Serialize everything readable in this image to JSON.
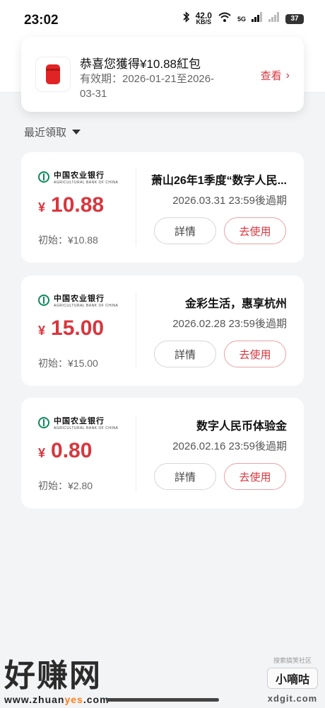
{
  "status_bar": {
    "time": "23:02",
    "net_speed_value": "42.0",
    "net_speed_unit": "KB/S",
    "signal_label": "5G",
    "battery": "37",
    "icons": [
      "bluetooth-icon",
      "wifi-icon",
      "signal-icon",
      "signal-icon"
    ]
  },
  "toast": {
    "title": "恭喜您獲得¥10.88紅包",
    "validity": "有效期：2026-01-21至2026-03-31",
    "action_label": "查看",
    "icon": "red-envelope-icon",
    "accent_color": "#d9363e"
  },
  "section": {
    "label": "最近領取"
  },
  "coupons": [
    {
      "bank_name_cn": "中国农业银行",
      "bank_name_en": "AGRICULTURAL BANK OF CHINA",
      "currency": "¥",
      "amount": "10.88",
      "initial": "初始：¥10.88",
      "title": "萧山26年1季度“数字人民...",
      "expiry": "2026.03.31 23:59後過期",
      "detail_label": "詳情",
      "use_label": "去使用"
    },
    {
      "bank_name_cn": "中国农业银行",
      "bank_name_en": "AGRICULTURAL BANK OF CHINA",
      "currency": "¥",
      "amount": "15.00",
      "initial": "初始：¥15.00",
      "title": "金彩生活，惠享杭州",
      "expiry": "2026.02.28 23:59後過期",
      "detail_label": "詳情",
      "use_label": "去使用"
    },
    {
      "bank_name_cn": "中国农业银行",
      "bank_name_en": "AGRICULTURAL BANK OF CHINA",
      "currency": "¥",
      "amount": "0.80",
      "initial": "初始：¥2.80",
      "title": "数字人民币体验金",
      "expiry": "2026.02.16 23:59後過期",
      "detail_label": "詳情",
      "use_label": "去使用"
    }
  ],
  "watermark": {
    "left_big": "好赚网",
    "left_url_prefix": "www.zhuan",
    "left_url_yes": "yes",
    "left_url_suffix": ".com",
    "right_small": "搜索搞笑社区",
    "right_badge": "小嘀咕",
    "right_domain": "xdgit.com"
  }
}
